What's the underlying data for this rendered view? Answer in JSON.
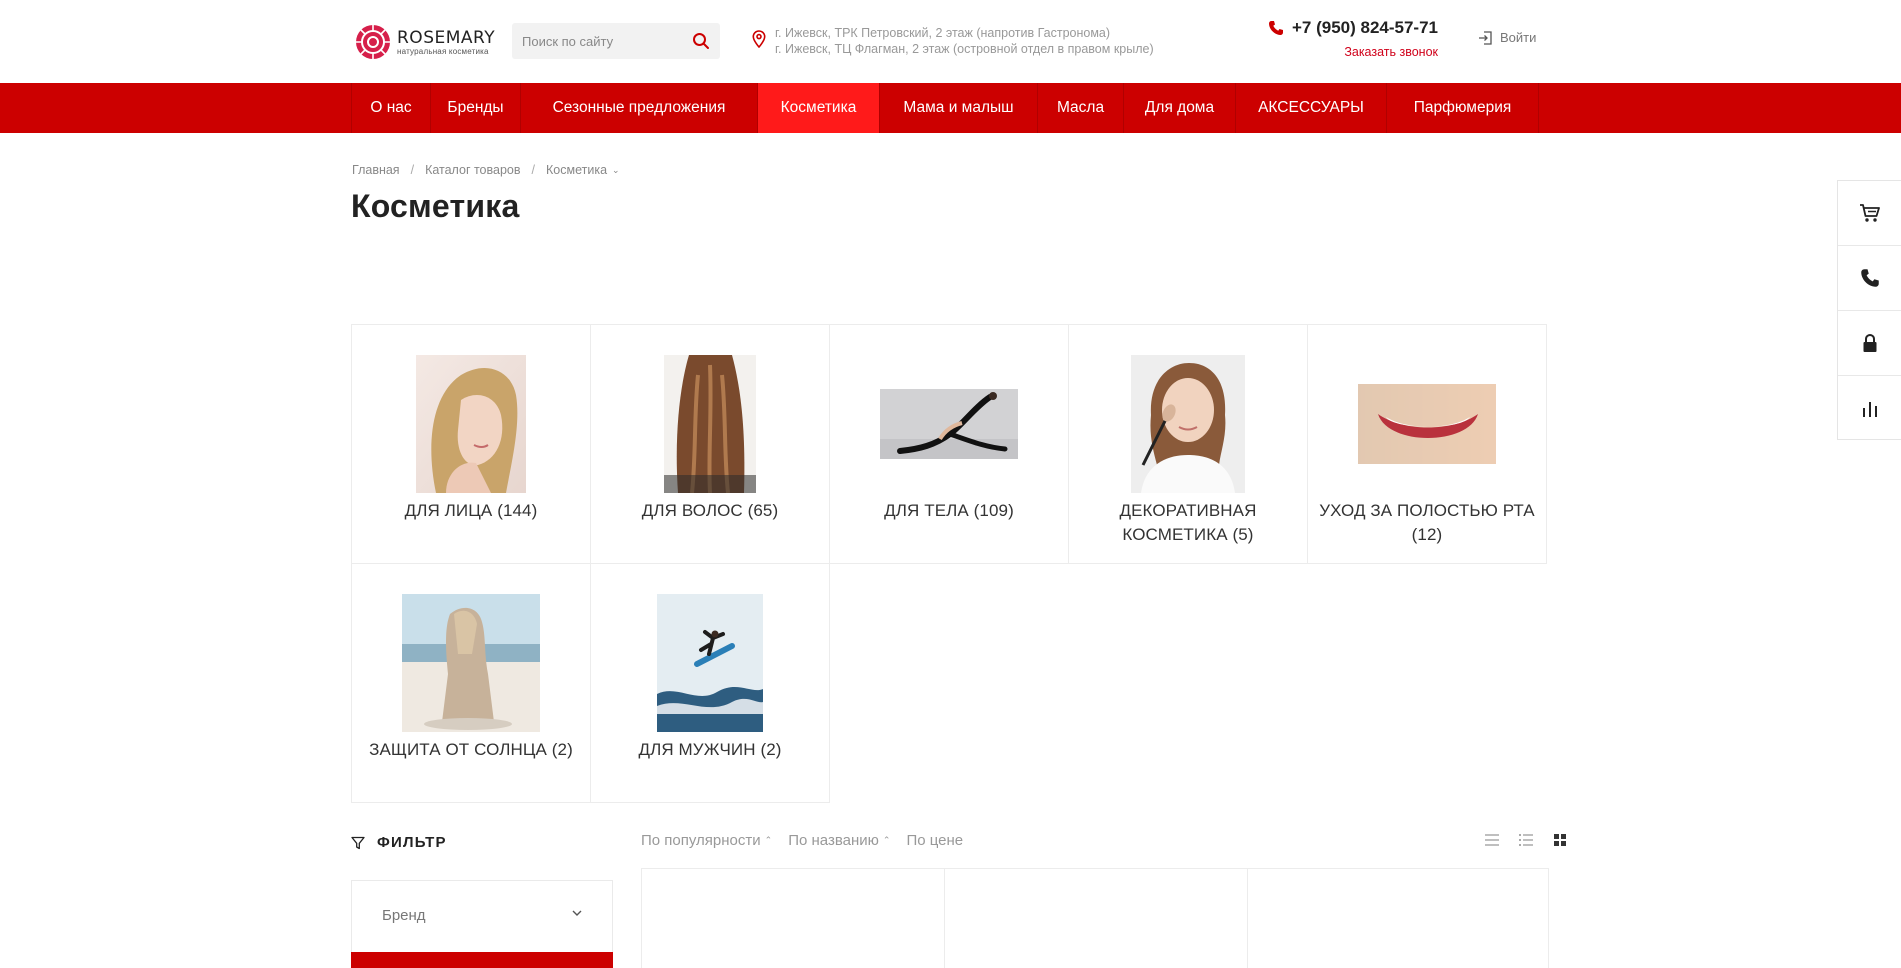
{
  "header": {
    "logo_name": "ROSEMARY",
    "logo_tagline": "натуральная косметика",
    "search_placeholder": "Поиск по сайту",
    "address_lines": [
      "г. Ижевск, ТРК Петровский, 2 этаж (напротив Гастронома)",
      "г. Ижевск, ТЦ Флагман, 2 этаж (островной отдел в правом крыле)"
    ],
    "phone": "+7 (950) 824-57-71",
    "callback_label": "Заказать звонок",
    "login_label": "Войти"
  },
  "nav": {
    "items": [
      {
        "label": "О нас"
      },
      {
        "label": "Бренды"
      },
      {
        "label": "Сезонные предложения"
      },
      {
        "label": "Косметика",
        "active": true
      },
      {
        "label": "Мама и малыш"
      },
      {
        "label": "Масла"
      },
      {
        "label": "Для дома"
      },
      {
        "label": "АКСЕССУАРЫ"
      },
      {
        "label": "Парфюмерия"
      }
    ]
  },
  "breadcrumb": {
    "items": [
      "Главная",
      "Каталог товаров",
      "Косметика"
    ]
  },
  "page_title": "Косметика",
  "categories": [
    {
      "label": "ДЛЯ ЛИЦА (144)",
      "image": "face-photo"
    },
    {
      "label": "ДЛЯ ВОЛОС (65)",
      "image": "hair-photo"
    },
    {
      "label": "ДЛЯ ТЕЛА (109)",
      "image": "body-photo"
    },
    {
      "label": "ДЕКОРАТИВНАЯ КОСМЕТИКА (5)",
      "image": "makeup-photo"
    },
    {
      "label": "УХОД ЗА ПОЛОСТЬЮ РТА (12)",
      "image": "smile-photo"
    },
    {
      "label": "ЗАЩИТА ОТ СОЛНЦА (2)",
      "image": "beach-photo"
    },
    {
      "label": "ДЛЯ МУЖЧИН (2)",
      "image": "surfer-photo"
    }
  ],
  "filter": {
    "title": "ФИЛЬТР",
    "brand_label": "Бренд"
  },
  "sort": {
    "items": [
      "По популярности",
      "По названию",
      "По цене"
    ]
  },
  "colors": {
    "brand_red": "#cc0000",
    "active_nav": "#ff1a1a",
    "link_red": "#d0021b"
  }
}
